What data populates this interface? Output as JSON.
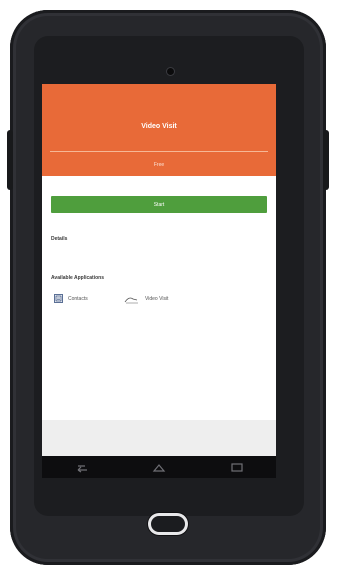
{
  "app": {
    "title": "Video Visit",
    "subtitle": "Free"
  },
  "actions": {
    "start_label": "Start"
  },
  "sections": {
    "details": "Details",
    "available_apps": "Available Applications"
  },
  "applications": [
    {
      "label": "Contacts",
      "icon": "contacts-icon"
    },
    {
      "label": "Video Visit",
      "icon": "video-visit-icon"
    }
  ],
  "navigation": {
    "buttons": [
      "back-icon",
      "home-icon",
      "recents-icon"
    ]
  },
  "colors": {
    "header": "#e86a38",
    "start_button": "#4f9e3d",
    "device": "#26272b"
  }
}
